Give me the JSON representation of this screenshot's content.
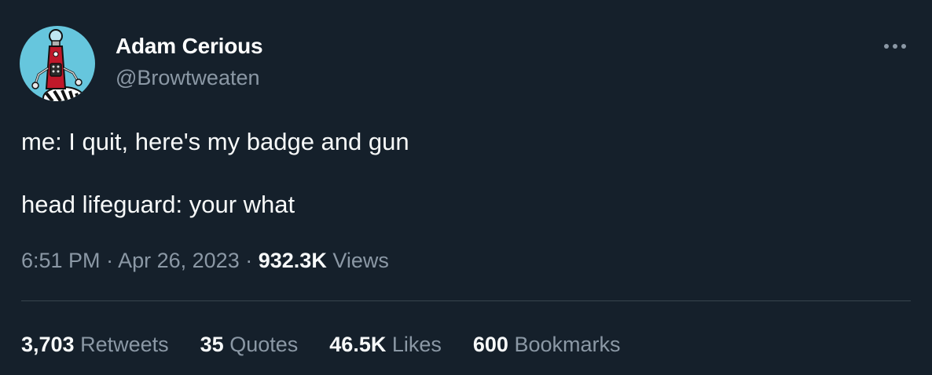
{
  "author": {
    "display_name": "Adam Cerious",
    "handle": "@Browtweaten"
  },
  "tweet": {
    "lines": [
      "me: I quit, here's my badge and gun",
      "head lifeguard: your what"
    ]
  },
  "meta": {
    "time": "6:51 PM",
    "separator": "·",
    "date": "Apr 26, 2023",
    "views_count": "932.3K",
    "views_label": "Views"
  },
  "stats": [
    {
      "count": "3,703",
      "label": "Retweets"
    },
    {
      "count": "35",
      "label": "Quotes"
    },
    {
      "count": "46.5K",
      "label": "Likes"
    },
    {
      "count": "600",
      "label": "Bookmarks"
    }
  ],
  "icons": {
    "more": "more-horizontal-icon",
    "avatar": "robot-avatar-icon"
  },
  "colors": {
    "background": "#15202b",
    "primary_text": "#f7f9f9",
    "secondary_text": "#8b98a5",
    "divider": "#38444d",
    "avatar_bg": "#66c6dd",
    "robot_red": "#c0182a"
  }
}
